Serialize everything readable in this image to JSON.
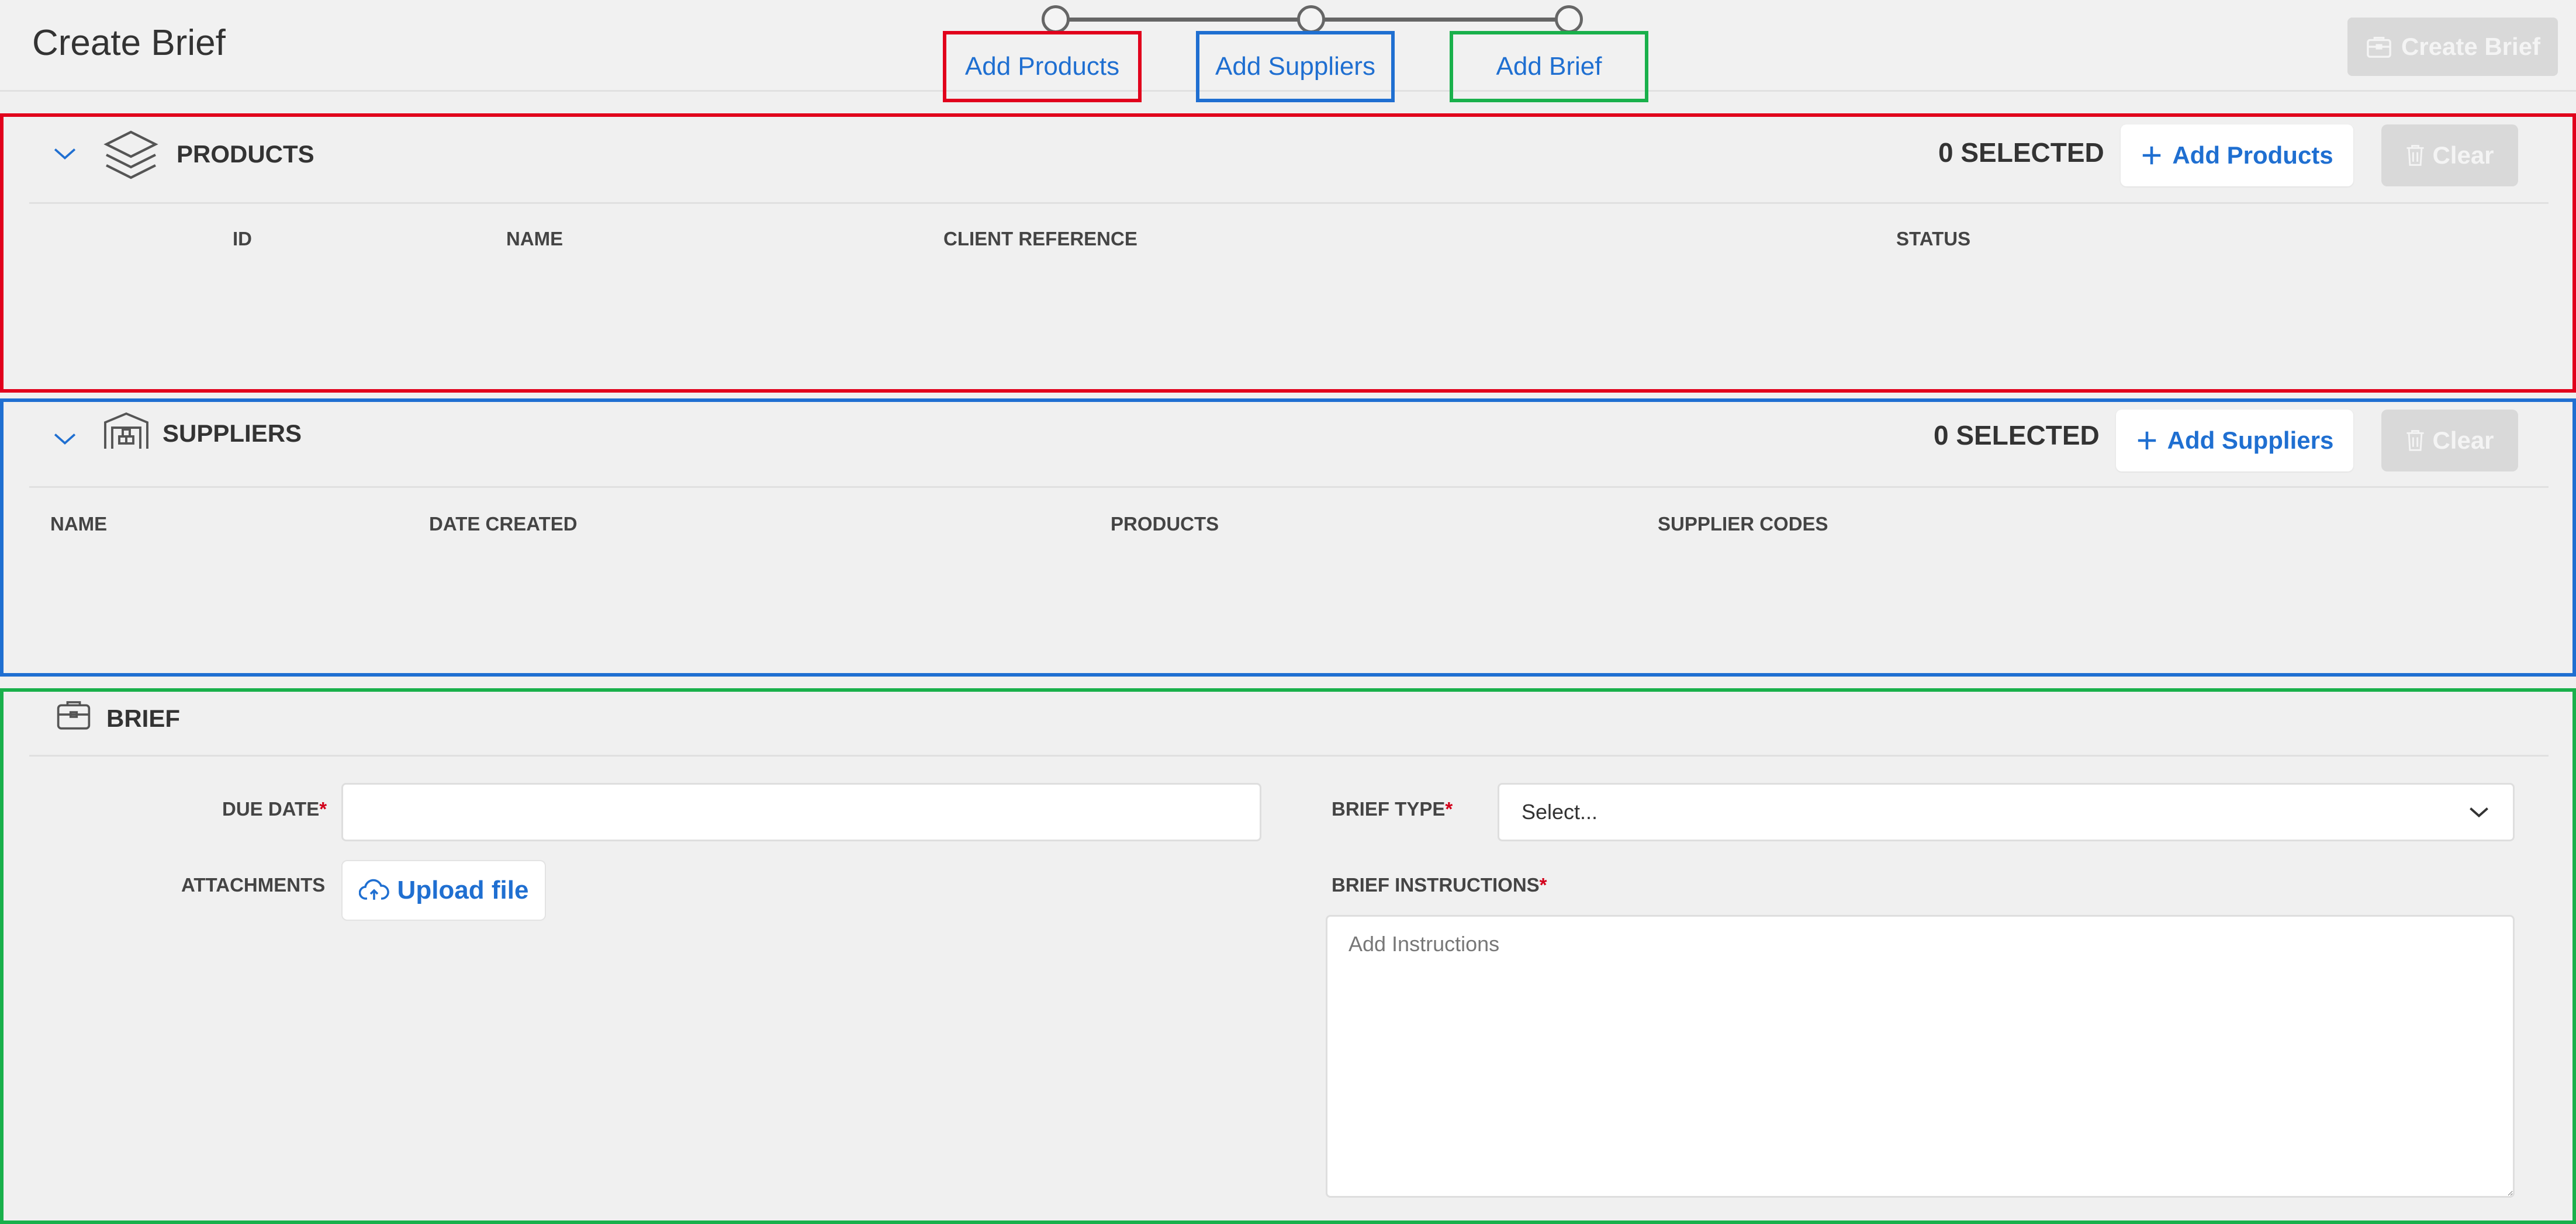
{
  "header": {
    "title": "Create Brief",
    "create_button_label": "Create Brief",
    "steps": [
      {
        "label": "Add Products",
        "color": "#e1001c"
      },
      {
        "label": "Add Suppliers",
        "color": "#1f6fd1"
      },
      {
        "label": "Add Brief",
        "color": "#19b04b"
      }
    ]
  },
  "products": {
    "title": "PRODUCTS",
    "selected_label": "0 SELECTED",
    "add_button_label": "Add Products",
    "clear_button_label": "Clear",
    "columns": [
      "ID",
      "NAME",
      "CLIENT REFERENCE",
      "STATUS"
    ]
  },
  "suppliers": {
    "title": "SUPPLIERS",
    "selected_label": "0 SELECTED",
    "add_button_label": "Add Suppliers",
    "clear_button_label": "Clear",
    "columns": [
      "NAME",
      "DATE CREATED",
      "PRODUCTS",
      "SUPPLIER CODES"
    ]
  },
  "brief": {
    "title": "BRIEF",
    "due_date_label": "DUE DATE",
    "due_date_value": "",
    "attachments_label": "ATTACHMENTS",
    "upload_button_label": "Upload file",
    "brief_type_label": "BRIEF TYPE",
    "brief_type_value": "Select...",
    "instructions_label": "BRIEF INSTRUCTIONS",
    "instructions_placeholder": "Add Instructions",
    "required_mark": "*"
  },
  "icons": {
    "collapse": "chevron-down-icon",
    "products": "layers-icon",
    "suppliers": "warehouse-icon",
    "brief": "briefcase-icon",
    "add": "plus-icon",
    "clear": "trash-icon",
    "upload": "cloud-upload-icon",
    "create": "briefcase-icon"
  },
  "colors": {
    "accent": "#1f6fd1",
    "products_outline": "#e1001c",
    "suppliers_outline": "#1f6fd1",
    "brief_outline": "#19b04b",
    "required": "#d2001a"
  }
}
